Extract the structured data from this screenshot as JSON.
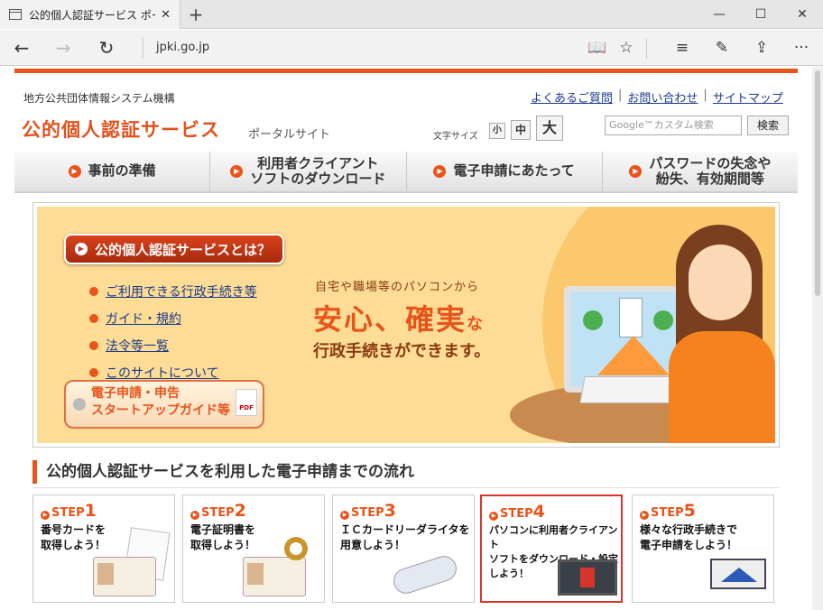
{
  "browser": {
    "tab_title": "公的個人認証サービス ポー",
    "tab_close": "✕",
    "new_tab": "+",
    "url": "jpki.go.jp",
    "controls": {
      "minimize": "—",
      "maximize": "☐",
      "close": "✕"
    },
    "nav": {
      "back": "←",
      "forward": "→",
      "refresh": "↻"
    },
    "actions": {
      "reading": "📖",
      "favorite": "☆",
      "hub": "≡",
      "notes": "✎",
      "share": "⇪",
      "more": "···"
    }
  },
  "header": {
    "org": "地方公共団体情報システム機構",
    "links": [
      "よくあるご質問",
      "お問い合わせ",
      "サイトマップ"
    ],
    "link_sep": "|",
    "title": "公的個人認証サービス",
    "subtitle": "ポータルサイト",
    "font_size_label": "文字サイズ",
    "font_sizes": [
      "小",
      "中",
      "大"
    ],
    "search_placeholder": "Google™カスタム検索",
    "search_button": "検索"
  },
  "global_nav": [
    {
      "label": "事前の準備"
    },
    {
      "label": "利用者クライアント\nソフトのダウンロード"
    },
    {
      "label": "電子申請にあたって"
    },
    {
      "label": "パスワードの失念や\n紛失、有効期間等"
    }
  ],
  "banner": {
    "what_button": "公的個人認証サービスとは？",
    "links": [
      "ご利用できる行政手続き等",
      "ガイド・規約",
      "法令等一覧",
      "このサイトについて"
    ],
    "guide_button_line1": "電子申請・申告",
    "guide_button_line2": "スタートアップガイド等",
    "pdf_label": "PDF",
    "tagline1": "自宅や職場等のパソコンから",
    "tagline2": "安心、確実",
    "tagline2_suffix": "な",
    "tagline3": "行政手続きができます。"
  },
  "flow": {
    "heading": "公的個人認証サービスを利用した電子申請までの流れ",
    "steps": [
      {
        "label": "STEP",
        "num": "1",
        "text": "番号カードを\n取得しよう！"
      },
      {
        "label": "STEP",
        "num": "2",
        "text": "電子証明書を\n取得しよう！"
      },
      {
        "label": "STEP",
        "num": "3",
        "text": "ＩＣカードリーダライタを\n用意しよう！"
      },
      {
        "label": "STEP",
        "num": "4",
        "text": "パソコンに利用者クライアント\nソフトをダウンロード・設定\nしよう！"
      },
      {
        "label": "STEP",
        "num": "5",
        "text": "様々な行政手続きで\n電子申請をしよう！"
      }
    ]
  },
  "colors": {
    "accent": "#e8541a",
    "link": "#1a3a8a",
    "banner_bg": "#fddc95"
  }
}
